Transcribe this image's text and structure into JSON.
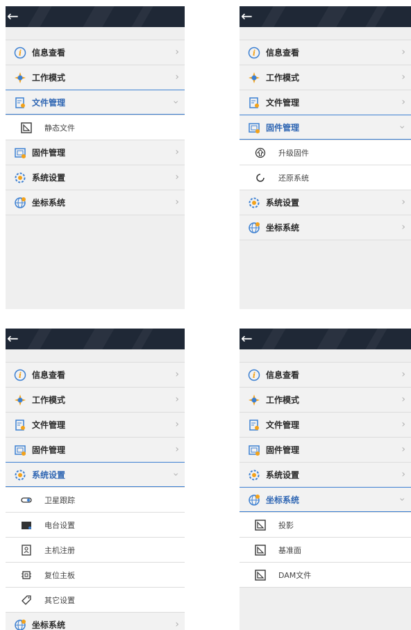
{
  "back_symbol": "←",
  "chevron": "›",
  "panels": [
    {
      "rows": [
        {
          "type": "main",
          "icon": "info-icon",
          "label": "信息查看"
        },
        {
          "type": "main",
          "icon": "compass-icon",
          "label": "工作模式"
        },
        {
          "type": "main",
          "icon": "file-icon",
          "label": "文件管理",
          "expanded": true
        },
        {
          "type": "sub",
          "icon": "triangle-doc-icon",
          "label": "静态文件"
        },
        {
          "type": "main",
          "icon": "firmware-icon",
          "label": "固件管理"
        },
        {
          "type": "main",
          "icon": "gear-icon",
          "label": "系统设置"
        },
        {
          "type": "main",
          "icon": "globe-icon",
          "label": "坐标系统"
        }
      ]
    },
    {
      "rows": [
        {
          "type": "main",
          "icon": "info-icon",
          "label": "信息查看"
        },
        {
          "type": "main",
          "icon": "compass-icon",
          "label": "工作模式"
        },
        {
          "type": "main",
          "icon": "file-icon",
          "label": "文件管理"
        },
        {
          "type": "main",
          "icon": "firmware-icon",
          "label": "固件管理",
          "expanded": true
        },
        {
          "type": "sub",
          "icon": "upload-icon",
          "label": "升级固件"
        },
        {
          "type": "sub",
          "icon": "restore-icon",
          "label": "还原系统"
        },
        {
          "type": "main",
          "icon": "gear-icon",
          "label": "系统设置"
        },
        {
          "type": "main",
          "icon": "globe-icon",
          "label": "坐标系统"
        }
      ]
    },
    {
      "rows": [
        {
          "type": "main",
          "icon": "info-icon",
          "label": "信息查看"
        },
        {
          "type": "main",
          "icon": "compass-icon",
          "label": "工作模式"
        },
        {
          "type": "main",
          "icon": "file-icon",
          "label": "文件管理"
        },
        {
          "type": "main",
          "icon": "firmware-icon",
          "label": "固件管理"
        },
        {
          "type": "main",
          "icon": "gear-icon",
          "label": "系统设置",
          "expanded": true
        },
        {
          "type": "sub",
          "icon": "toggle-icon",
          "label": "卫星跟踪"
        },
        {
          "type": "sub",
          "icon": "radio-icon",
          "label": "电台设置"
        },
        {
          "type": "sub",
          "icon": "user-icon",
          "label": "主机注册"
        },
        {
          "type": "sub",
          "icon": "chip-icon",
          "label": "复位主板"
        },
        {
          "type": "sub",
          "icon": "tag-icon",
          "label": "其它设置"
        },
        {
          "type": "main",
          "icon": "globe-icon",
          "label": "坐标系统"
        }
      ]
    },
    {
      "rows": [
        {
          "type": "main",
          "icon": "info-icon",
          "label": "信息查看"
        },
        {
          "type": "main",
          "icon": "compass-icon",
          "label": "工作模式"
        },
        {
          "type": "main",
          "icon": "file-icon",
          "label": "文件管理"
        },
        {
          "type": "main",
          "icon": "firmware-icon",
          "label": "固件管理"
        },
        {
          "type": "main",
          "icon": "gear-icon",
          "label": "系统设置"
        },
        {
          "type": "main",
          "icon": "globe-icon",
          "label": "坐标系统",
          "expanded": true
        },
        {
          "type": "sub",
          "icon": "triangle-doc-icon",
          "label": "投影"
        },
        {
          "type": "sub",
          "icon": "triangle-doc-icon",
          "label": "基准面"
        },
        {
          "type": "sub",
          "icon": "triangle-doc-icon",
          "label": "DAM文件"
        }
      ]
    }
  ],
  "colors": {
    "accent": "#2f66b3",
    "topbar": "#1f2836",
    "orange": "#f3a21a",
    "blue": "#3b7fd1"
  }
}
